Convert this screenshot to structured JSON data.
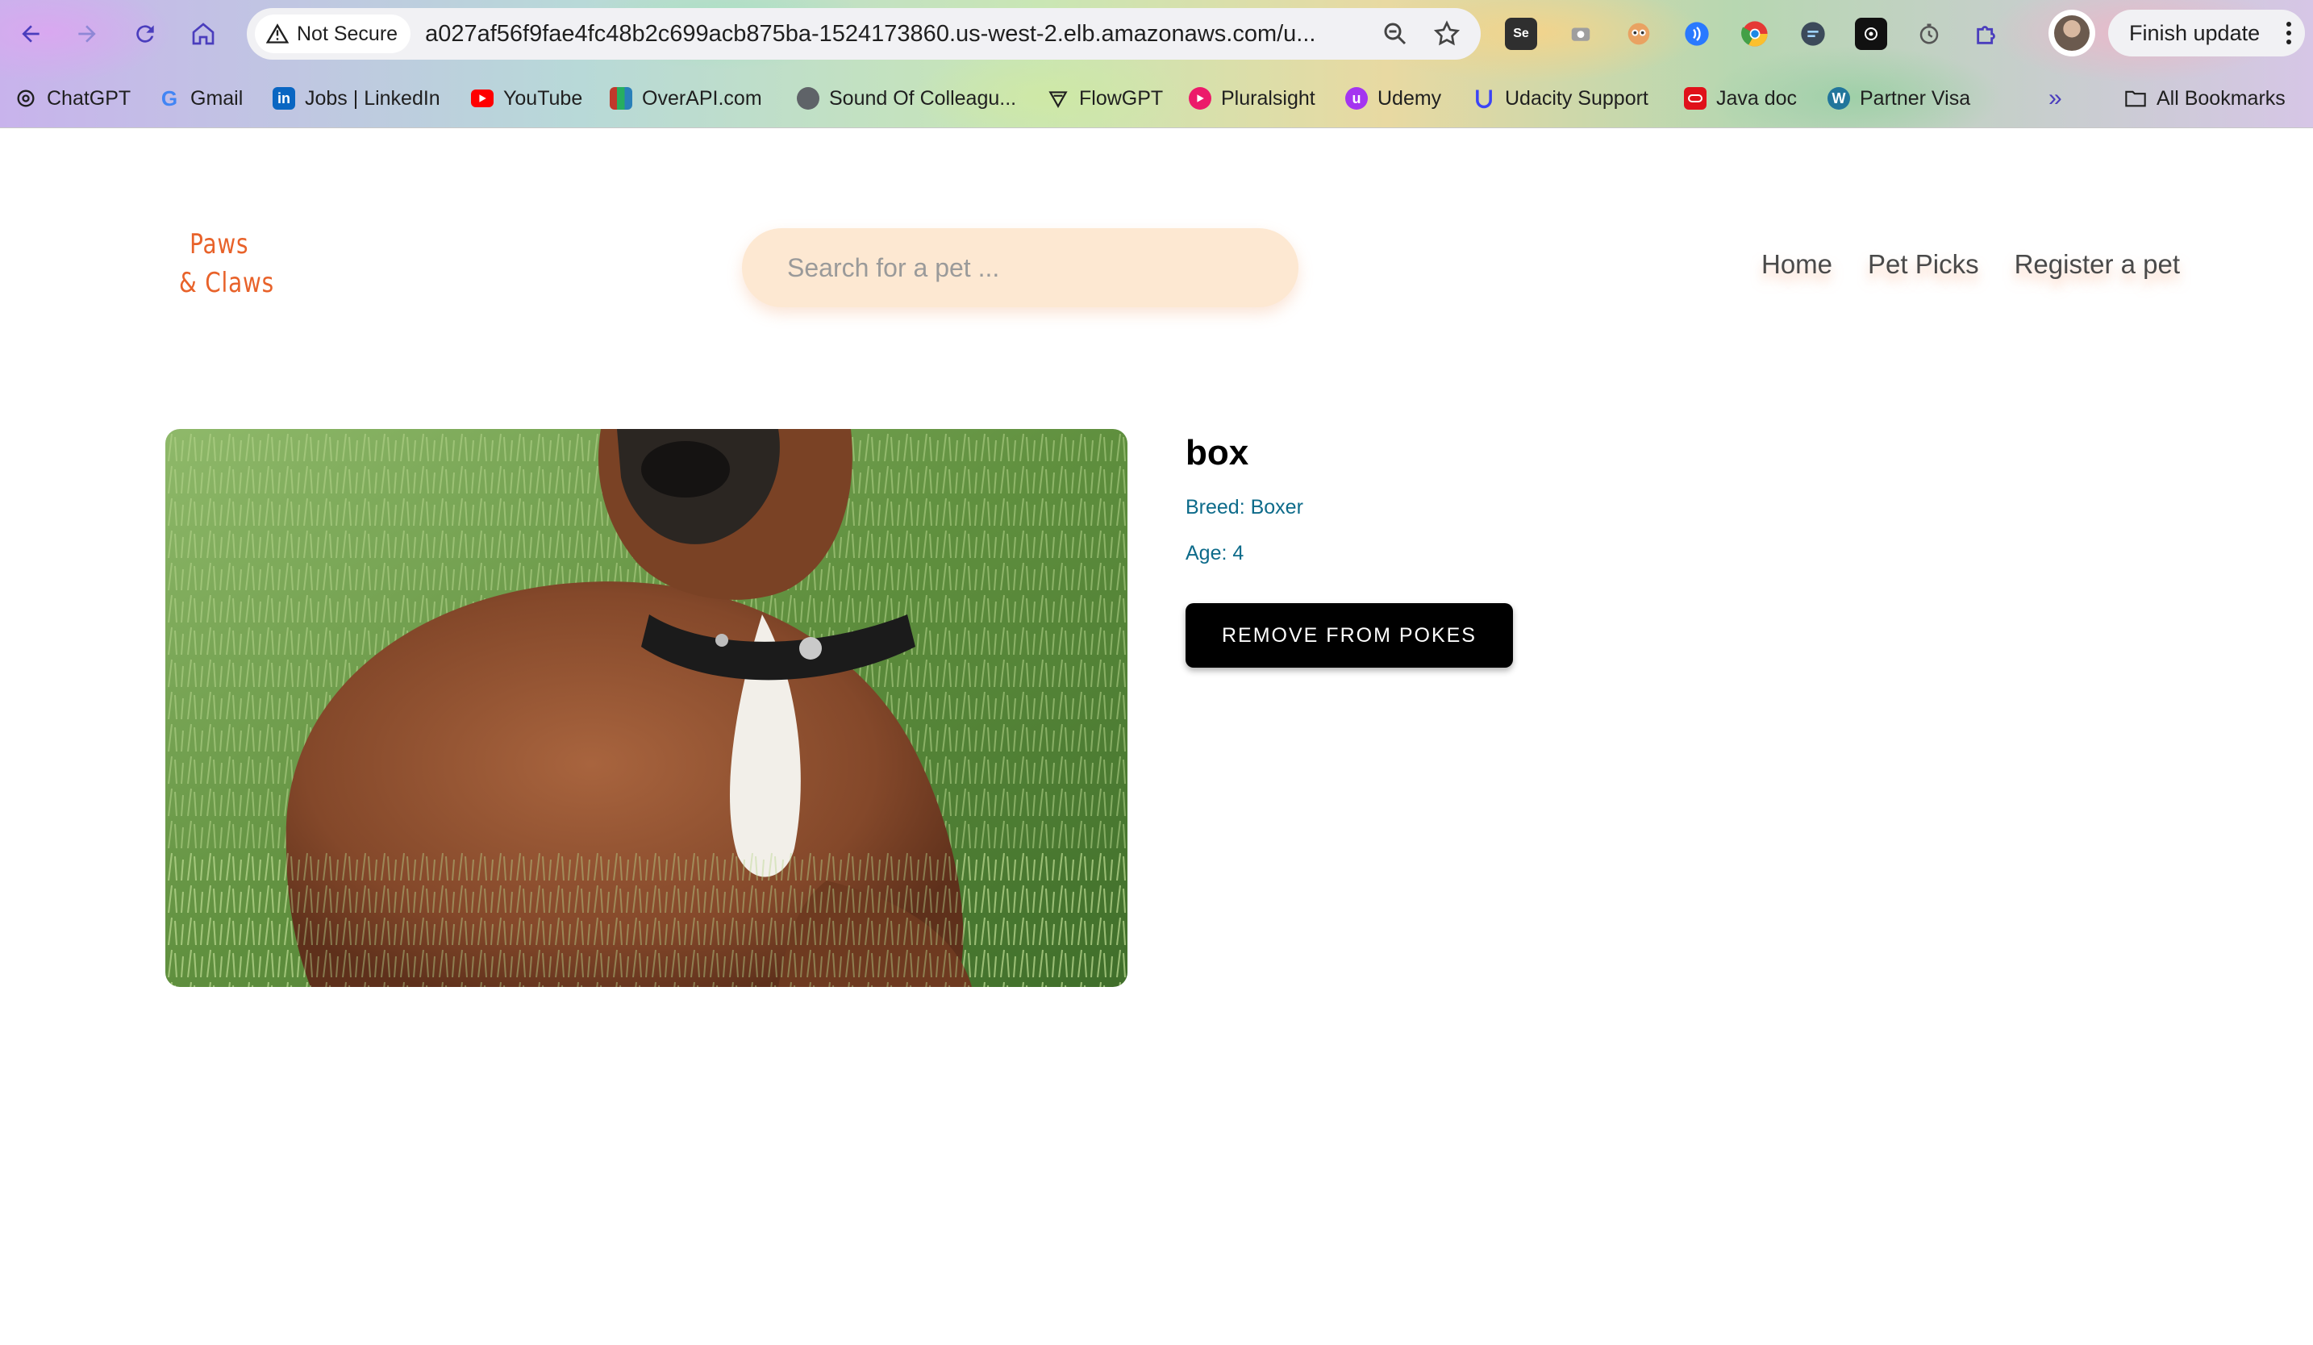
{
  "browser": {
    "security_label": "Not Secure",
    "url": "a027af56f9fae4fc48b2c699acb875ba-1524173860.us-west-2.elb.amazonaws.com/u...",
    "finish_update_label": "Finish update",
    "bookmarks": [
      {
        "label": "ChatGPT",
        "icon": "chatgpt-icon",
        "color": "#1f1f1f"
      },
      {
        "label": "Gmail",
        "icon": "google-icon",
        "color": "#4285f4"
      },
      {
        "label": "Jobs | LinkedIn",
        "icon": "linkedin-icon",
        "color": "#0a66c2"
      },
      {
        "label": "YouTube",
        "icon": "youtube-icon",
        "color": "#ff0000"
      },
      {
        "label": "OverAPI.com",
        "icon": "overapi-icon",
        "color": "#c0392b"
      },
      {
        "label": "Sound Of Colleagu...",
        "icon": "globe-icon",
        "color": "#5f6368"
      },
      {
        "label": "FlowGPT",
        "icon": "flowgpt-icon",
        "color": "#1f1f1f"
      },
      {
        "label": "Pluralsight",
        "icon": "pluralsight-icon",
        "color": "#ec1a6a"
      },
      {
        "label": "Udemy",
        "icon": "udemy-icon",
        "color": "#a435f0"
      },
      {
        "label": "Udacity Support",
        "icon": "udacity-icon",
        "color": "#3b44f6"
      },
      {
        "label": "Java doc",
        "icon": "oracle-icon",
        "color": "#e0111a"
      },
      {
        "label": "Partner Visa",
        "icon": "wordpress-icon",
        "color": "#21759b"
      }
    ],
    "all_bookmarks_label": "All Bookmarks"
  },
  "site": {
    "logo_line1": "Paws",
    "logo_line2": "& Claws",
    "search_placeholder": "Search for a pet ...",
    "nav": [
      "Home",
      "Pet Picks",
      "Register a pet"
    ]
  },
  "pet": {
    "name": "box",
    "breed": "Breed: Boxer",
    "age": "Age: 4",
    "action_label": "REMOVE FROM POKES"
  },
  "colors": {
    "logo": "#e8622a",
    "search_bg": "#fde8d2",
    "detail_text": "#0d6b8a",
    "button_bg": "#000000"
  }
}
